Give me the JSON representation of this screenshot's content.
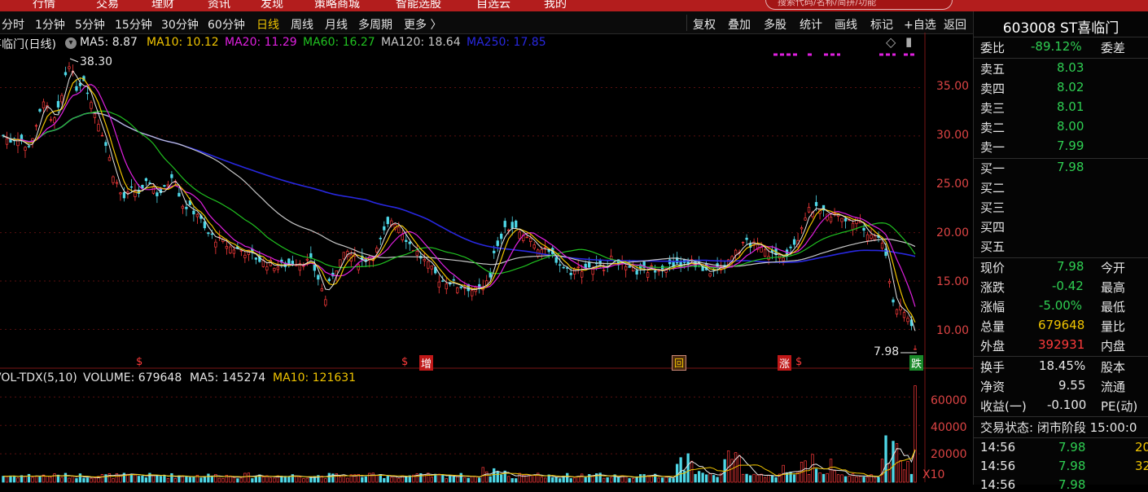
{
  "top_nav": {
    "items": [
      "行情",
      "交易",
      "理财",
      "资讯",
      "发现",
      "策略商城",
      "智能选股",
      "自选云",
      "我的"
    ],
    "search_placeholder": "搜索代码/名称/简拼/功能"
  },
  "toolbar": {
    "periods": [
      "分时",
      "1分钟",
      "5分钟",
      "15分钟",
      "30分钟",
      "60分钟",
      "日线",
      "周线",
      "月线",
      "多周期",
      "更多 〉"
    ],
    "active_period": "日线",
    "tools": [
      "复权",
      "叠加",
      "多股",
      "统计",
      "画线",
      "标记",
      "+自选",
      "返回"
    ]
  },
  "ma_info": {
    "name": "喜临门(日线)",
    "ma5": "MA5: 8.87",
    "ma10": "MA10: 10.12",
    "ma20": "MA20: 11.29",
    "ma60": "MA60: 16.27",
    "ma120": "MA120: 18.64",
    "ma250": "MA250: 17.85"
  },
  "vol_info": {
    "name": "VOL-TDX(5,10)",
    "volume": "VOLUME: 679648",
    "ma5": "MA5: 145274",
    "ma10": "MA10: 121631",
    "unit": "X10"
  },
  "annotations": {
    "high": "38.30",
    "last": "7.98",
    "events": [
      "$",
      "$",
      "增",
      "回",
      "涨",
      "$",
      "跌"
    ]
  },
  "price_axis": [
    "35.00",
    "30.00",
    "25.00",
    "20.00",
    "15.00",
    "10.00"
  ],
  "volume_axis": [
    "60000",
    "40000",
    "20000"
  ],
  "right_panel": {
    "title": "603008 ST喜临门",
    "webi": {
      "label": "委比",
      "value": "-89.12%",
      "label2": "委差"
    },
    "asks": [
      {
        "label": "卖五",
        "price": "8.03"
      },
      {
        "label": "卖四",
        "price": "8.02"
      },
      {
        "label": "卖三",
        "price": "8.01"
      },
      {
        "label": "卖二",
        "price": "8.00"
      },
      {
        "label": "卖一",
        "price": "7.99"
      }
    ],
    "bids": [
      {
        "label": "买一",
        "price": "7.98"
      },
      {
        "label": "买二",
        "price": ""
      },
      {
        "label": "买三",
        "price": ""
      },
      {
        "label": "买四",
        "price": ""
      },
      {
        "label": "买五",
        "price": ""
      }
    ],
    "stats": [
      {
        "label": "现价",
        "value": "7.98",
        "label2": "今开"
      },
      {
        "label": "涨跌",
        "value": "-0.42",
        "label2": "最高"
      },
      {
        "label": "涨幅",
        "value": "-5.00%",
        "label2": "最低"
      },
      {
        "label": "总量",
        "value": "679648",
        "label2": "量比"
      },
      {
        "label": "外盘",
        "value": "392931",
        "label2": "内盘"
      }
    ],
    "stats2": [
      {
        "label": "换手",
        "value": "18.45%",
        "label2": "股本"
      },
      {
        "label": "净资",
        "value": "9.55",
        "label2": "流通"
      },
      {
        "label": "收益(一)",
        "value": "-0.100",
        "label2": "PE(动)"
      }
    ],
    "trade_status": "交易状态: 闭市阶段 15:00:0",
    "ticks": [
      {
        "time": "14:56",
        "price": "7.98",
        "vol": "20"
      },
      {
        "time": "14:56",
        "price": "7.98",
        "vol": "32"
      },
      {
        "time": "14:56",
        "price": "7.98",
        "vol": ""
      }
    ]
  },
  "chart_data": {
    "type": "candlestick",
    "price_ylim": [
      7,
      39
    ],
    "volume_ylim": [
      0,
      70000
    ],
    "x_count": 250,
    "close_keypoints": [
      [
        0,
        30
      ],
      [
        8,
        29.5
      ],
      [
        20,
        30
      ],
      [
        28,
        28.5
      ],
      [
        40,
        30.5
      ],
      [
        50,
        34
      ],
      [
        60,
        31
      ],
      [
        70,
        33
      ],
      [
        80,
        38
      ],
      [
        90,
        35
      ],
      [
        100,
        36
      ],
      [
        110,
        33
      ],
      [
        120,
        31
      ],
      [
        130,
        28
      ],
      [
        136,
        26
      ],
      [
        145,
        24
      ],
      [
        150,
        23.5
      ],
      [
        160,
        24.5
      ],
      [
        170,
        24
      ],
      [
        180,
        25.5
      ],
      [
        190,
        24
      ],
      [
        200,
        24.5
      ],
      [
        210,
        26.5
      ],
      [
        220,
        23
      ],
      [
        240,
        22
      ],
      [
        250,
        20
      ],
      [
        260,
        19.5
      ],
      [
        270,
        19
      ],
      [
        280,
        18.5
      ],
      [
        300,
        18
      ],
      [
        320,
        17
      ],
      [
        340,
        16.5
      ],
      [
        360,
        17
      ],
      [
        380,
        17
      ],
      [
        390,
        15
      ],
      [
        397,
        13
      ],
      [
        405,
        15.5
      ],
      [
        415,
        17
      ],
      [
        425,
        18
      ],
      [
        440,
        17
      ],
      [
        460,
        18
      ],
      [
        470,
        20
      ],
      [
        480,
        21.5
      ],
      [
        490,
        20.5
      ],
      [
        500,
        19
      ],
      [
        510,
        18
      ],
      [
        520,
        17
      ],
      [
        530,
        16
      ],
      [
        540,
        15
      ],
      [
        550,
        15
      ],
      [
        560,
        14.5
      ],
      [
        570,
        14.5
      ],
      [
        580,
        14
      ],
      [
        590,
        14
      ],
      [
        600,
        15
      ],
      [
        605,
        18
      ],
      [
        610,
        19
      ],
      [
        620,
        20.5
      ],
      [
        630,
        20.5
      ],
      [
        640,
        19.5
      ],
      [
        650,
        19.5
      ],
      [
        660,
        18.5
      ],
      [
        670,
        18
      ],
      [
        680,
        17.5
      ],
      [
        690,
        16.5
      ],
      [
        700,
        16
      ],
      [
        720,
        16.5
      ],
      [
        740,
        16.5
      ],
      [
        755,
        17.5
      ],
      [
        770,
        16
      ],
      [
        790,
        16
      ],
      [
        810,
        16.5
      ],
      [
        830,
        16.5
      ],
      [
        850,
        17
      ],
      [
        870,
        16
      ],
      [
        890,
        16.5
      ],
      [
        900,
        18
      ],
      [
        920,
        19
      ],
      [
        940,
        18
      ],
      [
        960,
        17.5
      ],
      [
        980,
        19.5
      ],
      [
        990,
        22
      ],
      [
        1000,
        22.5
      ],
      [
        1010,
        22
      ],
      [
        1020,
        21.5
      ],
      [
        1030,
        22
      ],
      [
        1040,
        21
      ],
      [
        1050,
        21.5
      ],
      [
        1060,
        20.5
      ],
      [
        1070,
        20
      ],
      [
        1080,
        19.5
      ],
      [
        1085,
        18.5
      ],
      [
        1090,
        17
      ],
      [
        1095,
        14
      ],
      [
        1100,
        12.5
      ],
      [
        1110,
        12
      ],
      [
        1118,
        11
      ],
      [
        1125,
        8
      ]
    ],
    "ma_colors": {
      "ma5": "#e6e6e6",
      "ma10": "#f0c400",
      "ma20": "#e020e0",
      "ma60": "#20c020",
      "ma120": "#c8c8c8",
      "ma250": "#2828e0"
    }
  }
}
